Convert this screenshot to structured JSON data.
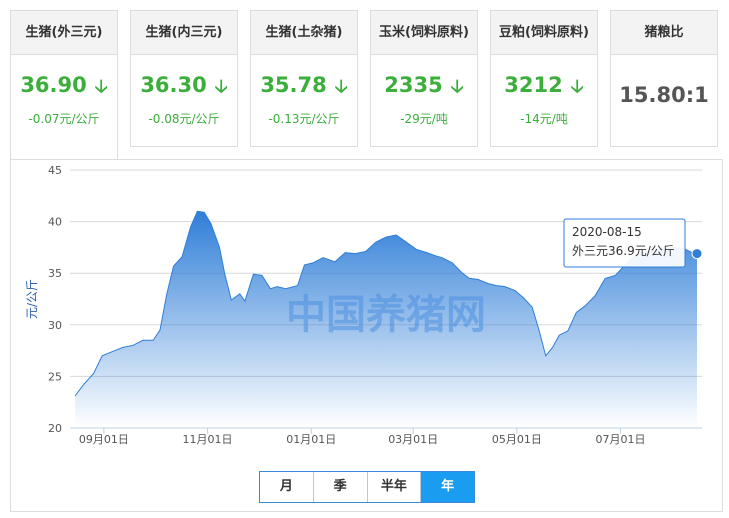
{
  "cards": [
    {
      "title": "生猪(外三元)",
      "value": "36.90",
      "arrow": "🡣",
      "change": "-0.07元/公斤"
    },
    {
      "title": "生猪(内三元)",
      "value": "36.30",
      "arrow": "🡣",
      "change": "-0.08元/公斤"
    },
    {
      "title": "生猪(土杂猪)",
      "value": "35.78",
      "arrow": "🡣",
      "change": "-0.13元/公斤"
    },
    {
      "title": "玉米(饲料原料)",
      "value": "2335",
      "arrow": "🡣",
      "change": "-29元/吨"
    },
    {
      "title": "豆粕(饲料原料)",
      "value": "3212",
      "arrow": "🡣",
      "change": "-14元/吨"
    },
    {
      "title": "猪粮比",
      "value": "15.80:1",
      "arrow": "",
      "change": ""
    }
  ],
  "colors": {
    "up_down_green": "#3cae3c",
    "series_line": "#2f7ed8",
    "tab_active": "#1a9cf0"
  },
  "watermark": "中国养猪网",
  "tooltip": {
    "date": "2020-08-15",
    "text": "外三元36.9元/公斤"
  },
  "tabs": [
    "月",
    "季",
    "半年",
    "年"
  ],
  "active_tab": "年",
  "chart_data": {
    "type": "area",
    "ylabel": "元/公斤",
    "ylim": [
      20,
      45
    ],
    "yticks": [
      20,
      25,
      30,
      35,
      40,
      45
    ],
    "xlim": [
      "2019-08-15",
      "2020-08-15"
    ],
    "xticks": [
      {
        "date": "2019-09-01",
        "label": "09月01日"
      },
      {
        "date": "2019-11-01",
        "label": "11月01日"
      },
      {
        "date": "2020-01-01",
        "label": "01月01日"
      },
      {
        "date": "2020-03-01",
        "label": "03月01日"
      },
      {
        "date": "2020-05-01",
        "label": "05月01日"
      },
      {
        "date": "2020-07-01",
        "label": "07月01日"
      }
    ],
    "grid": true,
    "series": [
      {
        "name": "外三元",
        "points": [
          [
            "2019-08-15",
            23.1
          ],
          [
            "2019-08-20",
            24.2
          ],
          [
            "2019-08-26",
            25.3
          ],
          [
            "2019-08-31",
            27.0
          ],
          [
            "2019-09-06",
            27.4
          ],
          [
            "2019-09-12",
            27.8
          ],
          [
            "2019-09-18",
            28.0
          ],
          [
            "2019-09-24",
            28.5
          ],
          [
            "2019-09-30",
            28.5
          ],
          [
            "2019-10-04",
            29.5
          ],
          [
            "2019-10-08",
            33.0
          ],
          [
            "2019-10-12",
            35.7
          ],
          [
            "2019-10-17",
            36.6
          ],
          [
            "2019-10-22",
            39.5
          ],
          [
            "2019-10-26",
            41.0
          ],
          [
            "2019-10-30",
            40.9
          ],
          [
            "2019-11-03",
            39.8
          ],
          [
            "2019-11-08",
            37.5
          ],
          [
            "2019-11-11",
            35.0
          ],
          [
            "2019-11-15",
            32.4
          ],
          [
            "2019-11-20",
            33.0
          ],
          [
            "2019-11-23",
            32.3
          ],
          [
            "2019-11-28",
            34.9
          ],
          [
            "2019-12-03",
            34.8
          ],
          [
            "2019-12-08",
            33.5
          ],
          [
            "2019-12-12",
            33.7
          ],
          [
            "2019-12-17",
            33.5
          ],
          [
            "2019-12-24",
            33.8
          ],
          [
            "2019-12-28",
            35.8
          ],
          [
            "2020-01-02",
            36.0
          ],
          [
            "2020-01-08",
            36.5
          ],
          [
            "2020-01-15",
            36.1
          ],
          [
            "2020-01-21",
            37.0
          ],
          [
            "2020-01-27",
            36.9
          ],
          [
            "2020-02-02",
            37.1
          ],
          [
            "2020-02-08",
            38.0
          ],
          [
            "2020-02-14",
            38.5
          ],
          [
            "2020-02-20",
            38.7
          ],
          [
            "2020-02-26",
            38.0
          ],
          [
            "2020-03-03",
            37.3
          ],
          [
            "2020-03-09",
            37.0
          ],
          [
            "2020-03-14",
            36.7
          ],
          [
            "2020-03-18",
            36.5
          ],
          [
            "2020-03-24",
            36.0
          ],
          [
            "2020-03-30",
            35.0
          ],
          [
            "2020-04-03",
            34.5
          ],
          [
            "2020-04-08",
            34.4
          ],
          [
            "2020-04-14",
            34.0
          ],
          [
            "2020-04-19",
            33.8
          ],
          [
            "2020-04-24",
            33.7
          ],
          [
            "2020-04-30",
            33.3
          ],
          [
            "2020-05-05",
            32.6
          ],
          [
            "2020-05-10",
            31.7
          ],
          [
            "2020-05-14",
            29.5
          ],
          [
            "2020-05-18",
            27.0
          ],
          [
            "2020-05-22",
            27.8
          ],
          [
            "2020-05-26",
            29.0
          ],
          [
            "2020-05-31",
            29.4
          ],
          [
            "2020-06-05",
            31.2
          ],
          [
            "2020-06-10",
            31.8
          ],
          [
            "2020-06-16",
            32.8
          ],
          [
            "2020-06-22",
            34.5
          ],
          [
            "2020-06-28",
            34.8
          ],
          [
            "2020-07-02",
            35.5
          ],
          [
            "2020-07-08",
            36.5
          ],
          [
            "2020-07-14",
            37.0
          ],
          [
            "2020-07-20",
            37.2
          ],
          [
            "2020-07-26",
            37.4
          ],
          [
            "2020-08-01",
            37.5
          ],
          [
            "2020-08-07",
            37.4
          ],
          [
            "2020-08-12",
            37.0
          ],
          [
            "2020-08-15",
            36.9
          ]
        ]
      }
    ]
  }
}
